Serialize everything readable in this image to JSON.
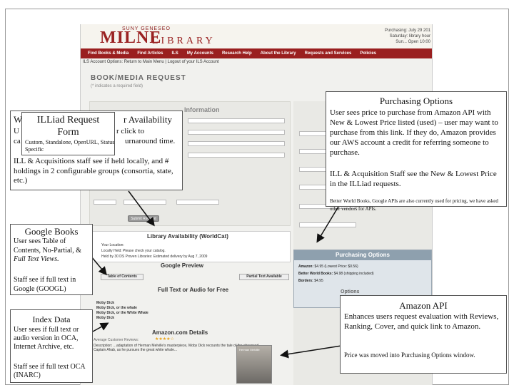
{
  "screenshot": {
    "logo_top": "SUNY GENESEO",
    "logo_main": "MILNE",
    "logo_sub": "LIBRARY",
    "header_right": [
      "Purchasing: July 29 201",
      "Saturday: library hour",
      "Sun... Open 10:00"
    ],
    "nav": [
      "Find Books & Media",
      "Find Articles",
      "ILS",
      "My Accounts",
      "Research Help",
      "About the Library",
      "Requests and Services",
      "Policies"
    ],
    "account_options": "ILS Account Options: Return to Main Menu | Logout of your ILS Account",
    "page_title": "BOOK/MEDIA REQUEST",
    "page_subtitle": "(* indicates a required field)",
    "form_section": "Information",
    "worldcat": {
      "title": "Library Availability (WorldCat)",
      "lines": [
        "Your Location:",
        "Locally Held: Please check your catalog.",
        "Held by 30 DS Proven Libraries: Estimated delivery by Aug 7, 2009"
      ]
    },
    "google_preview": {
      "title": "Google Preview",
      "left_button": "Table of Contents",
      "right_button": "Partial Text Available"
    },
    "full_text": {
      "title": "Full Text or Audio for Free",
      "items": [
        "Moby Dick",
        "Moby Dick, or the whale",
        "Moby Dick, or the White Whale",
        "Moby Dick"
      ]
    },
    "amazon": {
      "title": "Amazon.com Details",
      "rating_label": "Average Customer Reviews:",
      "stars": "★★★★☆",
      "description": "Description: ...adaptation of Herman Melville's masterpiece, Moby Dick recounts the tale of the obsessed Captain Ahab, as he pursues the great white whale...",
      "cover_title": "Herman Melville"
    },
    "purchasing": {
      "header": "Purchasing Options",
      "rows": [
        {
          "label": "Amazon:",
          "value": "$4.95 (Lowest Price: $0.56)"
        },
        {
          "label": "Better World Books:",
          "value": "$4.98 (shipping included)"
        },
        {
          "label": "Borders:",
          "value": "$4.95"
        }
      ]
    },
    "options_label": "Options",
    "submit_label": "Submit Request"
  },
  "annotations": {
    "purchasing_title": "Purchasing Options",
    "purchasing_body1": "User sees price to purchase from Amazon API with New & Lowest Price listed (used) – user may want to purchase from this link. If they do, Amazon provides our AWS account a credit for referring someone to purchase.",
    "purchasing_body2": "ILL & Acquisition Staff see the New & Lowest Price in the ILLiad requests.",
    "purchasing_body3": "Better World Books, Google APIs are also currently used for pricing, we have asked other vendors for APIs.",
    "availability_title_start": "W",
    "availability_title_end": "r Availability",
    "availability_line1_start": "U",
    "availability_line1_end": "r click to",
    "availability_line2_start": "ca",
    "availability_line2_end": "urnaround time.",
    "availability_body": "ILL & Acquisitions staff see if held locally, and # holdings in 2 configurable groups (consortia, state, etc.)",
    "illiad_title_line1": "ILLiad Request",
    "illiad_title_line2": "Form",
    "illiad_body": "Custom, Standalone, OpenURL, Status Specific",
    "google_title": "Google Books",
    "google_body1": "User sees Table of Contents, No-Partial, & ",
    "google_body1_italic": "Full Text Views.",
    "google_body2": "Staff see if full text in Google (GOOGL)",
    "index_title": "Index Data",
    "index_body1": "User sees if full text or audio version in OCA, Internet Archive, etc.",
    "index_body2": "Staff see if full text OCA (INARC)",
    "amazon_title": "Amazon API",
    "amazon_body1": "Enhances users request evaluation with Reviews, Ranking, Cover, and quick link to Amazon.",
    "amazon_body2": "Price was moved into Purchasing Options window."
  }
}
